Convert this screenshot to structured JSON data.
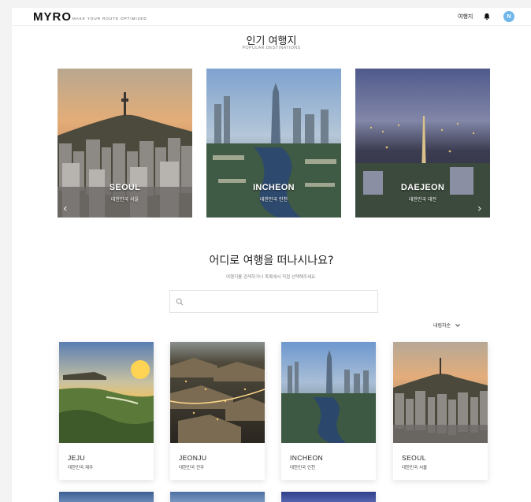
{
  "header": {
    "logo": "MYRO",
    "tagline": "MAKE YOUR ROUTE OPTIMIZED",
    "nav_link": "여행지",
    "avatar_initial": "N"
  },
  "popular": {
    "title": "인기 여행지",
    "subtitle": "POPULAR DESTINATIONS",
    "cards": [
      {
        "city": "SEOUL",
        "region": "대한민국 서울"
      },
      {
        "city": "INCHEON",
        "region": "대한민국 인천"
      },
      {
        "city": "DAEJEON",
        "region": "대한민국 대전"
      }
    ]
  },
  "search": {
    "title": "어디로 여행을 떠나시나요?",
    "subtitle": "여행지를 검색하거나 목록에서 직접 선택해주세요.",
    "placeholder": "",
    "sort_label": "내림차순"
  },
  "destinations": [
    {
      "city": "JEJU",
      "region": "대한민국 제주"
    },
    {
      "city": "JEONJU",
      "region": "대한민국 전주"
    },
    {
      "city": "INCHEON",
      "region": "대한민국 인천"
    },
    {
      "city": "SEOUL",
      "region": "대한민국 서울"
    }
  ],
  "colors": {
    "accent": "#6fb7ea",
    "text": "#222222",
    "muted": "#888888"
  }
}
